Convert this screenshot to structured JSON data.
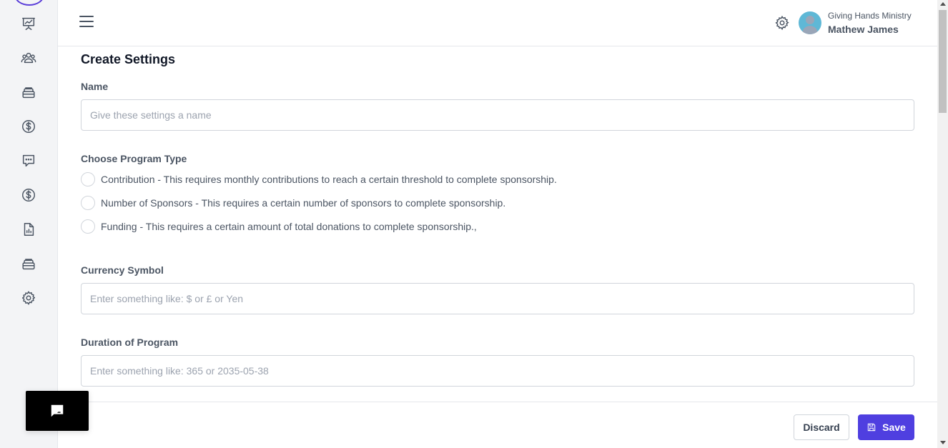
{
  "header": {
    "org_name": "Giving Hands Ministry",
    "user_name": "Mathew James"
  },
  "sidebar": {
    "items": [
      {
        "icon": "presentation-chart-icon"
      },
      {
        "icon": "user-group-icon"
      },
      {
        "icon": "archive-box-icon"
      },
      {
        "icon": "dollar-circle-icon"
      },
      {
        "icon": "chat-bubble-icon"
      },
      {
        "icon": "dollar-circle-icon"
      },
      {
        "icon": "document-chart-icon"
      },
      {
        "icon": "archive-box-icon"
      },
      {
        "icon": "gear-icon"
      }
    ]
  },
  "form": {
    "title": "Create Settings",
    "name": {
      "label": "Name",
      "placeholder": "Give these settings a name",
      "value": ""
    },
    "program_type": {
      "label": "Choose Program Type",
      "options": [
        {
          "text": "Contribution - This requires monthly contributions to reach a certain threshold to complete sponsorship.",
          "selected": false
        },
        {
          "text": "Number of Sponsors - This requires a certain number of sponsors to complete sponsorship.",
          "selected": false
        },
        {
          "text": "Funding - This requires a certain amount of total donations to complete sponsorship.,",
          "selected": false
        }
      ]
    },
    "currency": {
      "label": "Currency Symbol",
      "placeholder": "Enter something like: $ or £ or Yen",
      "value": ""
    },
    "duration": {
      "label": "Duration of Program",
      "placeholder": "Enter something like: 365 or 2035-05-38",
      "value": ""
    }
  },
  "footer": {
    "discard_label": "Discard",
    "save_label": "Save"
  },
  "colors": {
    "accent": "#4f3fe0",
    "sidebar_bg": "#f3f4f6"
  }
}
